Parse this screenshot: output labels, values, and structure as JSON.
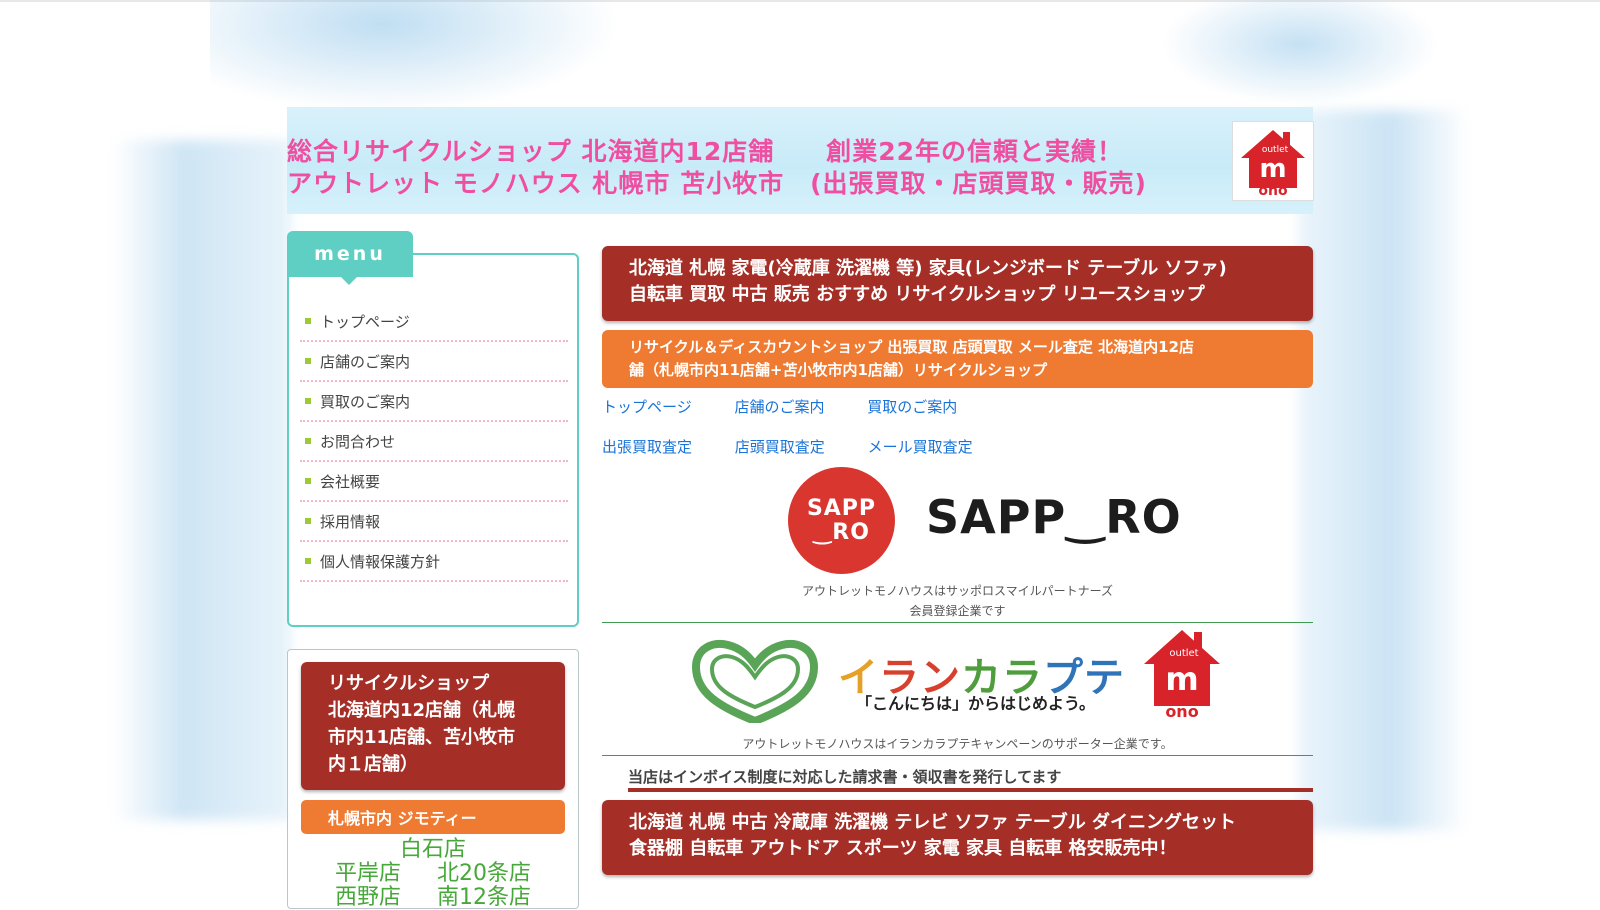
{
  "header": {
    "line1": "総合リサイクルショップ 北海道内12店舗　　創業22年の信頼と実績！",
    "line2": "アウトレット モノハウス 札幌市 苫小牧市　(出張買取・店頭買取・販売)",
    "logo_text_top": "outlet",
    "logo_text_main": "m",
    "logo_text_bottom": "ono"
  },
  "sidebar": {
    "menu_title": "menu",
    "items": [
      {
        "label": "トップページ"
      },
      {
        "label": "店舗のご案内"
      },
      {
        "label": "買取のご案内"
      },
      {
        "label": "お問合わせ"
      },
      {
        "label": "会社概要"
      },
      {
        "label": "採用情報"
      },
      {
        "label": "個人情報保護方針"
      }
    ],
    "recycle_box": {
      "line1": "リサイクルショップ",
      "line2": "北海道内12店舗（札幌",
      "line3": "市内11店舗、苫小牧市",
      "line4": "内１店舗）"
    },
    "jimoty_label": "札幌市内 ジモティー",
    "stores": {
      "row1": "白石店",
      "row2a": "平岸店",
      "row2b": "北20条店",
      "row3a": "西野店",
      "row3b": "南12条店"
    }
  },
  "main": {
    "red_banner": {
      "line1": "北海道 札幌 家電(冷蔵庫 洗濯機 等) 家具(レンジボード テーブル ソファ)",
      "line2": "自転車 買取 中古 販売 おすすめ リサイクルショップ リユースショップ"
    },
    "orange_banner": {
      "line1": "リサイクル＆ディスカウントショップ 出張買取 店頭買取 メール査定 北海道内12店",
      "line2": "舗（札幌市内11店舗+苫小牧市内1店舗）リサイクルショップ"
    },
    "links_row1": [
      "トップページ",
      "店舗のご案内",
      "買取のご案内"
    ],
    "links_row2": [
      "出張買取査定",
      "店頭買取査定",
      "メール買取査定"
    ],
    "sapporo": {
      "circle_top": "SAPP",
      "circle_bottom": "‿RO",
      "wordmark": "SAPP‿RO",
      "caption1": "アウトレットモノハウスはサッポロスマイルパートナーズ",
      "caption2": "会員登録企業です"
    },
    "ilankarapte": {
      "title_k1": "イ",
      "title_k2": "ラン",
      "title_k3": "カラ",
      "title_k4": "プテ",
      "subtitle": "「こんにちは」からはじめよう。",
      "caption": "アウトレットモノハウスはイランカラプテキャンペーンのサポーター企業です。"
    },
    "invoice_notice": "当店はインボイス制度に対応した請求書・領収書を発行してます",
    "red_banner2": {
      "line1": "北海道 札幌 中古 冷蔵庫 洗濯機 テレビ ソファ テーブル ダイニングセット",
      "line2": "食器棚 自転車 アウトドア スポーツ 家電 家具 自転車 格安販売中！"
    }
  },
  "colors": {
    "header_text": "#ef4fa1",
    "menu_accent": "#5fcfc4",
    "banner_red": "#a52f27",
    "banner_orange": "#ef7a31",
    "link_blue": "#1a73d6",
    "store_green": "#47a83a",
    "sapporo_red": "#d9362f"
  }
}
